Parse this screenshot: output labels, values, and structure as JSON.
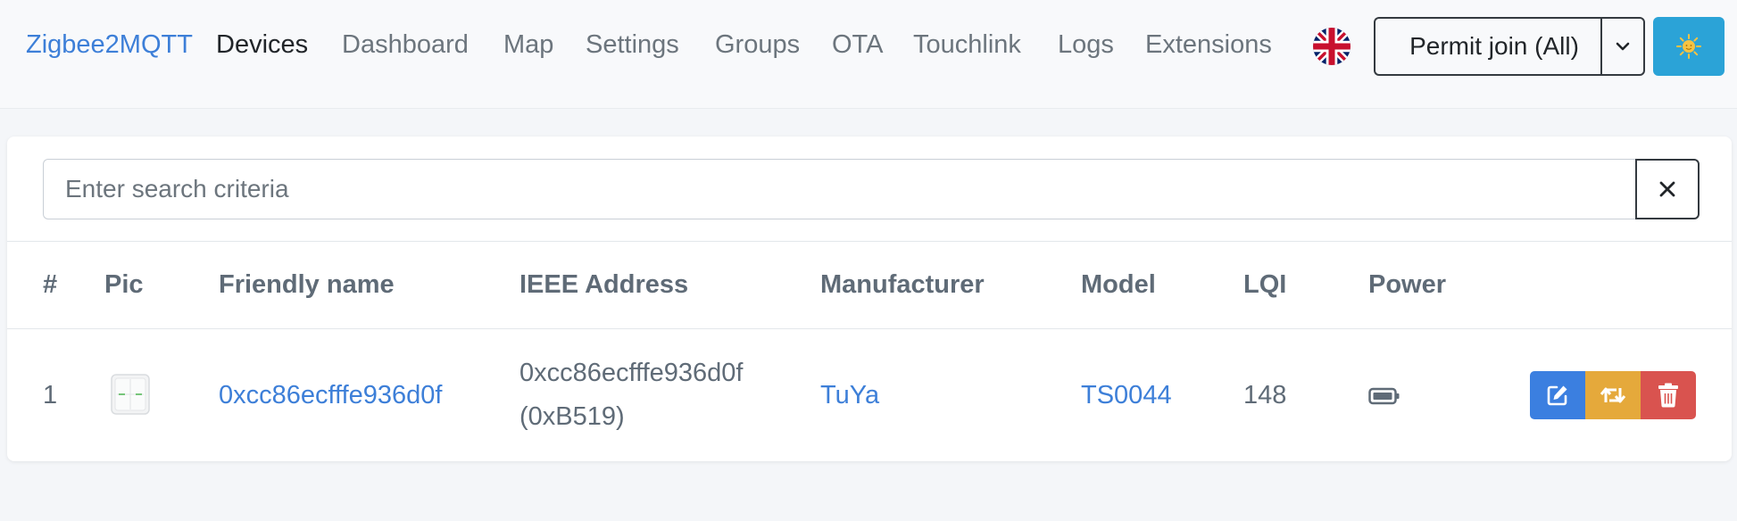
{
  "navbar": {
    "brand": "Zigbee2MQTT",
    "links": [
      {
        "label": "Devices",
        "active": true
      },
      {
        "label": "Dashboard"
      },
      {
        "label": "Map"
      },
      {
        "label": "Settings"
      },
      {
        "label": "Groups"
      },
      {
        "label": "OTA"
      },
      {
        "label": "Touchlink"
      },
      {
        "label": "Logs"
      },
      {
        "label": "Extensions"
      }
    ],
    "language_icon": "uk-flag-icon",
    "permit_join_label": "Permit join (All)",
    "theme_icon": "sun-icon"
  },
  "search": {
    "placeholder": "Enter search criteria",
    "value": ""
  },
  "table": {
    "columns": [
      "#",
      "Pic",
      "Friendly name",
      "IEEE Address",
      "Manufacturer",
      "Model",
      "LQI",
      "Power"
    ],
    "rows": [
      {
        "index": "1",
        "pic": "switch-device-image",
        "friendly_name": "0xcc86ecfffe936d0f",
        "ieee_address": "0xcc86ecfffe936d0f",
        "network_address": "(0xB519)",
        "manufacturer": "TuYa",
        "model": "TS0044",
        "lqi": "148",
        "power_icon": "battery-icon"
      }
    ]
  },
  "colors": {
    "accent": "#3d7fd8",
    "edit": "#3b7fe0",
    "rename": "#e5a93b",
    "remove": "#d9534f",
    "theme_button": "#2ba3d7"
  }
}
